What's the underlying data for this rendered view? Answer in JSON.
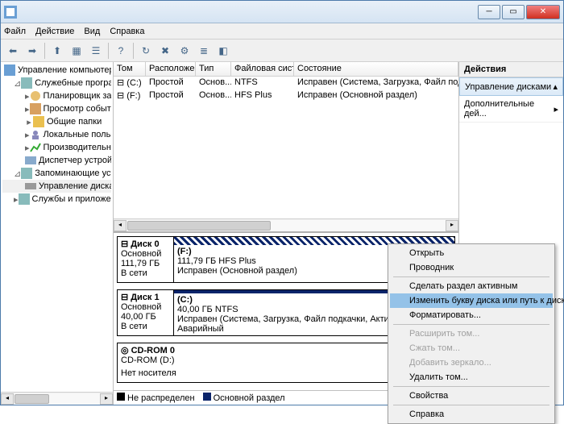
{
  "menubar": {
    "file": "Файл",
    "action": "Действие",
    "view": "Вид",
    "help": "Справка"
  },
  "tree": {
    "root": "Управление компьютером (л",
    "group1": "Служебные программы",
    "scheduler": "Планировщик заданий",
    "events": "Просмотр событий",
    "shared": "Общие папки",
    "users": "Локальные пользовате",
    "perf": "Производительность",
    "devmgr": "Диспетчер устройств",
    "group2": "Запоминающие устройст",
    "diskmgmt": "Управление дисками",
    "group3": "Службы и приложения"
  },
  "cols": {
    "volume": "Том",
    "layout": "Расположе...",
    "type": "Тип",
    "fs": "Файловая сист...",
    "state": "Состояние"
  },
  "vols": [
    {
      "name": "(C:)",
      "layout": "Простой",
      "type": "Основ...",
      "fs": "NTFS",
      "state": "Исправен (Система, Загрузка, Файл подкачки, Активен"
    },
    {
      "name": "(F:)",
      "layout": "Простой",
      "type": "Основ...",
      "fs": "HFS Plus",
      "state": "Исправен (Основной раздел)"
    }
  ],
  "disks": {
    "d0": {
      "name": "Диск 0",
      "kind": "Основной",
      "size": "111,79 ГБ",
      "status": "В сети",
      "part": {
        "letter": "(F:)",
        "detail": "111,79 ГБ HFS Plus",
        "state": "Исправен (Основной раздел)"
      }
    },
    "d1": {
      "name": "Диск 1",
      "kind": "Основной",
      "size": "40,00 ГБ",
      "status": "В сети",
      "part": {
        "letter": "(C:)",
        "detail": "40,00 ГБ NTFS",
        "state": "Исправен (Система, Загрузка, Файл подкачки, Активен, Аварийный"
      }
    },
    "cd": {
      "name": "CD-ROM 0",
      "sub": "CD-ROM (D:)",
      "status": "Нет носителя"
    }
  },
  "legend": {
    "unalloc": "Не распределен",
    "primary": "Основной раздел"
  },
  "actions": {
    "header": "Действия",
    "diskmgmt": "Управление дисками",
    "more": "Дополнительные дей..."
  },
  "ctx": {
    "open": "Открыть",
    "explorer": "Проводник",
    "active": "Сделать раздел активным",
    "letter": "Изменить букву диска или путь к диску...",
    "format": "Форматировать...",
    "extend": "Расширить том...",
    "shrink": "Сжать том...",
    "mirror": "Добавить зеркало...",
    "delete": "Удалить том...",
    "props": "Свойства",
    "help": "Справка"
  }
}
